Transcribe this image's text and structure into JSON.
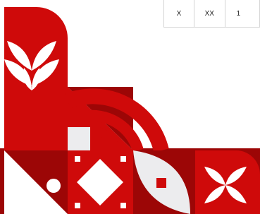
{
  "size_table": {
    "cells": [
      "X",
      "XX",
      "1"
    ]
  },
  "colors": {
    "red": "#cf0a0a",
    "dark_red": "#9c0606",
    "light_grey": "#ececee",
    "white": "#ffffff"
  },
  "illustration": {
    "icons": [
      "leaf-fan-icon",
      "concentric-arcs",
      "diamond-tile",
      "leaf-tile",
      "petal-cross-icon"
    ]
  }
}
